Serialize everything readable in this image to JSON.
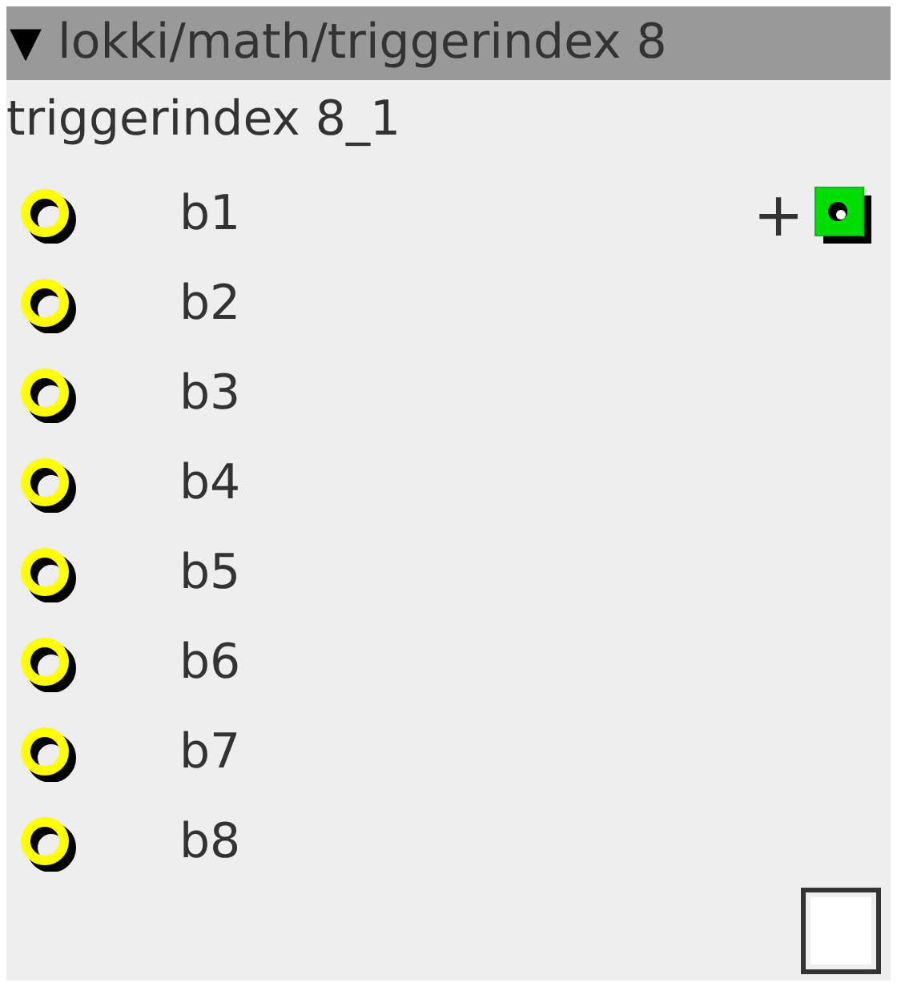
{
  "header": {
    "arrow": "▼",
    "title": "lokki/math/triggerindex 8",
    "expanded": true
  },
  "instance": "triggerindex 8_1",
  "inlets": [
    {
      "name": "b1",
      "output": {
        "symbol": "+"
      }
    },
    {
      "name": "b2"
    },
    {
      "name": "b3"
    },
    {
      "name": "b4"
    },
    {
      "name": "b5"
    },
    {
      "name": "b6"
    },
    {
      "name": "b7"
    },
    {
      "name": "b8"
    }
  ],
  "toggle": {
    "checked": false
  }
}
